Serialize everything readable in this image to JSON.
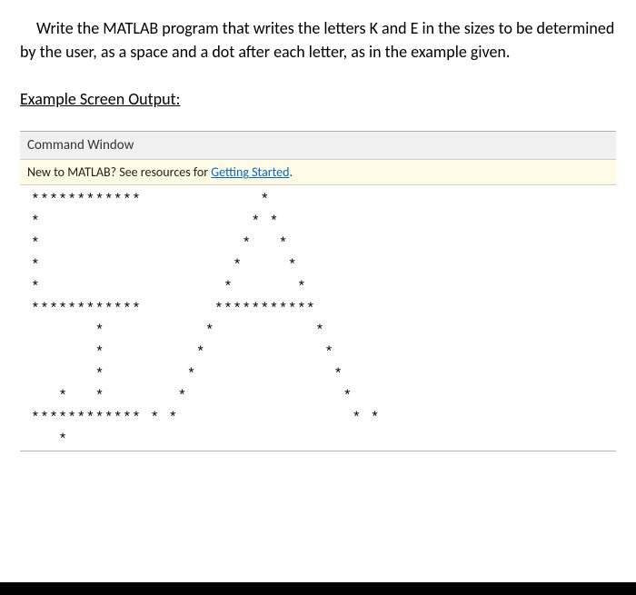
{
  "instruction": "Write the MATLAB program that writes the letters K and E in the sizes to be determined by the user, as a space and a dot after each letter, as in the example given.",
  "example_heading": "Example Screen Output:",
  "command_window": {
    "header": "Command Window",
    "banner_prefix": "New to MATLAB? See resources for ",
    "banner_link": "Getting Started",
    "banner_suffix": ".",
    "ascii_lines": [
      "************             *",
      "*                       * *",
      "*                      *   *",
      "*                     *     *",
      "*                    *       *",
      "************        ***********",
      "       *           *           *",
      "       *          *             *",
      "       *         *               *",
      "   *   *        *                 *",
      "************ * *                   * *",
      "   *"
    ]
  }
}
